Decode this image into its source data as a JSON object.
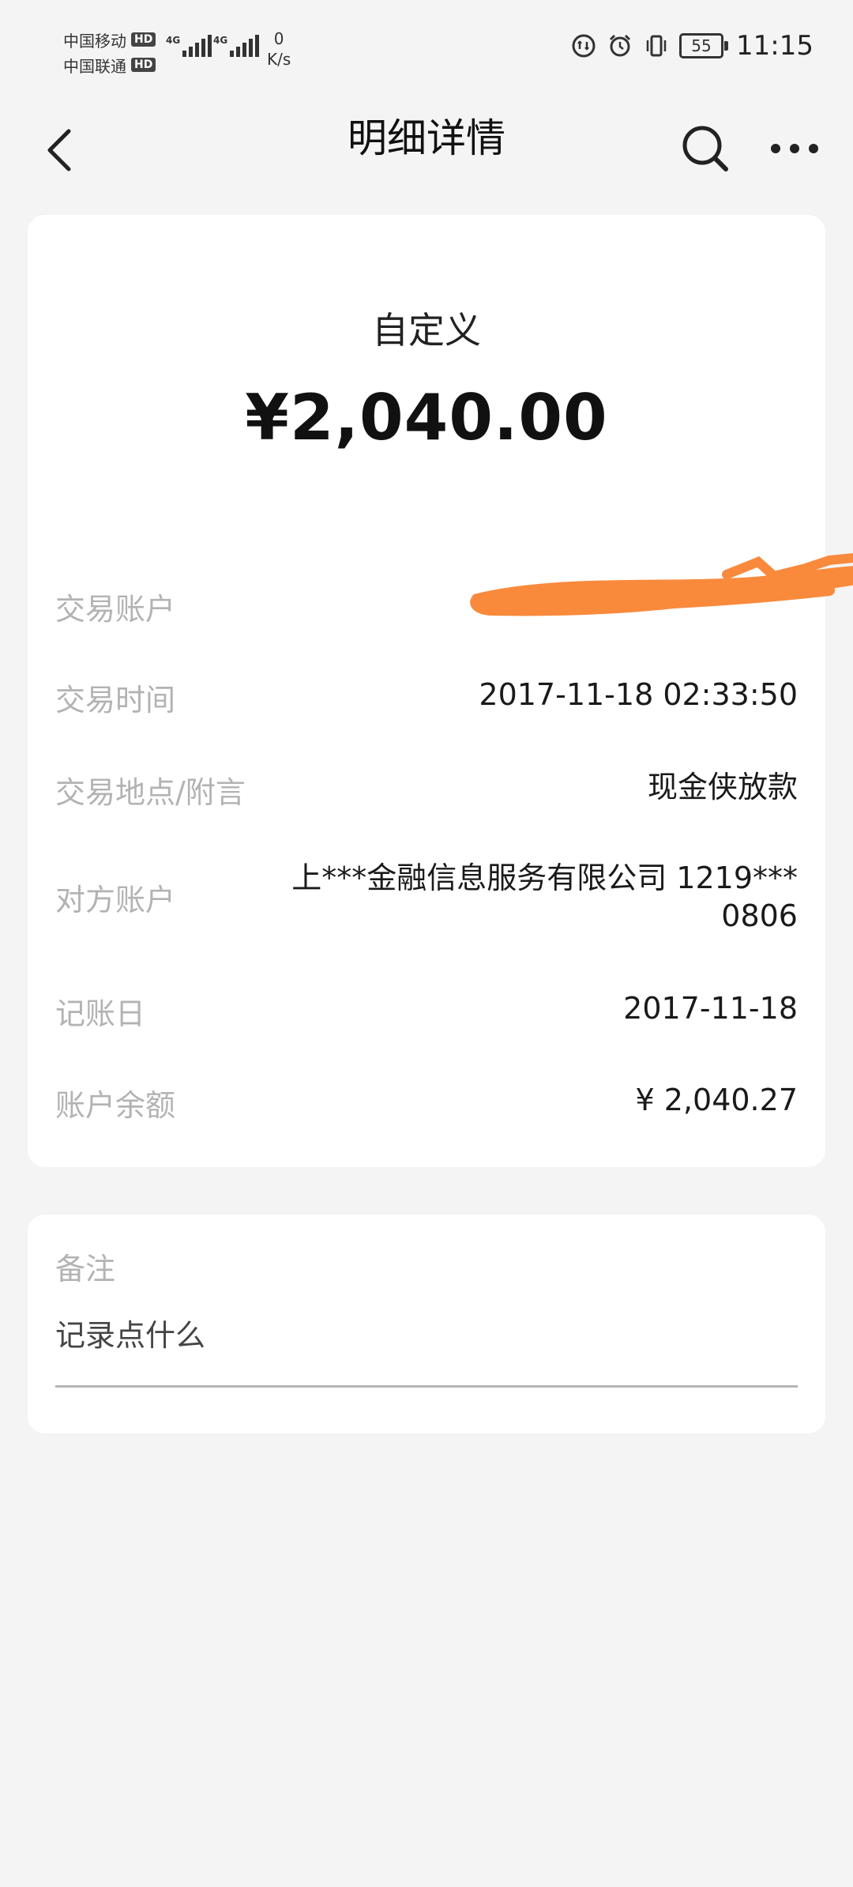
{
  "status_bar": {
    "carrier1": "中国移动",
    "carrier2": "中国联通",
    "hd_badge": "HD",
    "sig_tag": "4G",
    "net_speed_value": "0",
    "net_speed_unit": "K/s",
    "battery": "55",
    "time": "11:15"
  },
  "nav": {
    "title": "明细详情"
  },
  "detail": {
    "category": "自定义",
    "amount": "¥2,040.00",
    "rows": [
      {
        "label": "交易账户",
        "value": ""
      },
      {
        "label": "交易时间",
        "value": "2017-11-18 02:33:50"
      },
      {
        "label": "交易地点/附言",
        "value": "现金侠放款"
      },
      {
        "label": "对方账户",
        "value_line1": "上***金融信息服务有限公司 1219***",
        "value_line2": "0806"
      },
      {
        "label": "记账日",
        "value": "2017-11-18"
      },
      {
        "label": "账户余额",
        "value": "¥ 2,040.27"
      }
    ]
  },
  "note": {
    "label": "备注",
    "placeholder": "记录点什么"
  },
  "colors": {
    "background": "#f4f4f4",
    "card": "#ffffff",
    "label_gray": "#b3b3b3",
    "redaction_orange": "#f98a3c"
  }
}
